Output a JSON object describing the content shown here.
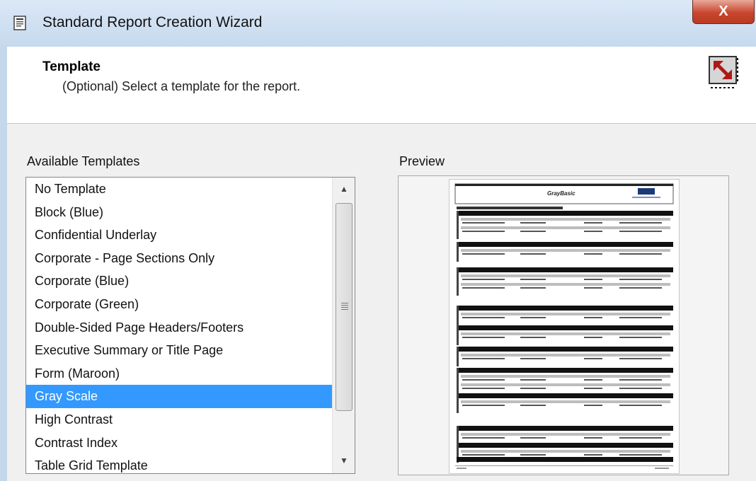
{
  "window": {
    "title": "Standard Report Creation Wizard",
    "close_label": "X"
  },
  "header": {
    "title": "Template",
    "subtitle": "(Optional) Select a template for the report."
  },
  "templates": {
    "label": "Available Templates",
    "items": [
      "No Template",
      "Block (Blue)",
      "Confidential Underlay",
      "Corporate - Page Sections Only",
      "Corporate (Blue)",
      "Corporate (Green)",
      "Double-Sided Page Headers/Footers",
      "Executive Summary or Title Page",
      "Form (Maroon)",
      "Gray Scale",
      "High Contrast",
      "Contrast Index",
      "Table Grid Template"
    ],
    "selected_index": 9
  },
  "preview": {
    "label": "Preview",
    "page_title": "GrayBasic"
  },
  "colors": {
    "selection": "#3399ff",
    "close_button": "#c8462d",
    "titlebar": "#c6d9ee"
  }
}
